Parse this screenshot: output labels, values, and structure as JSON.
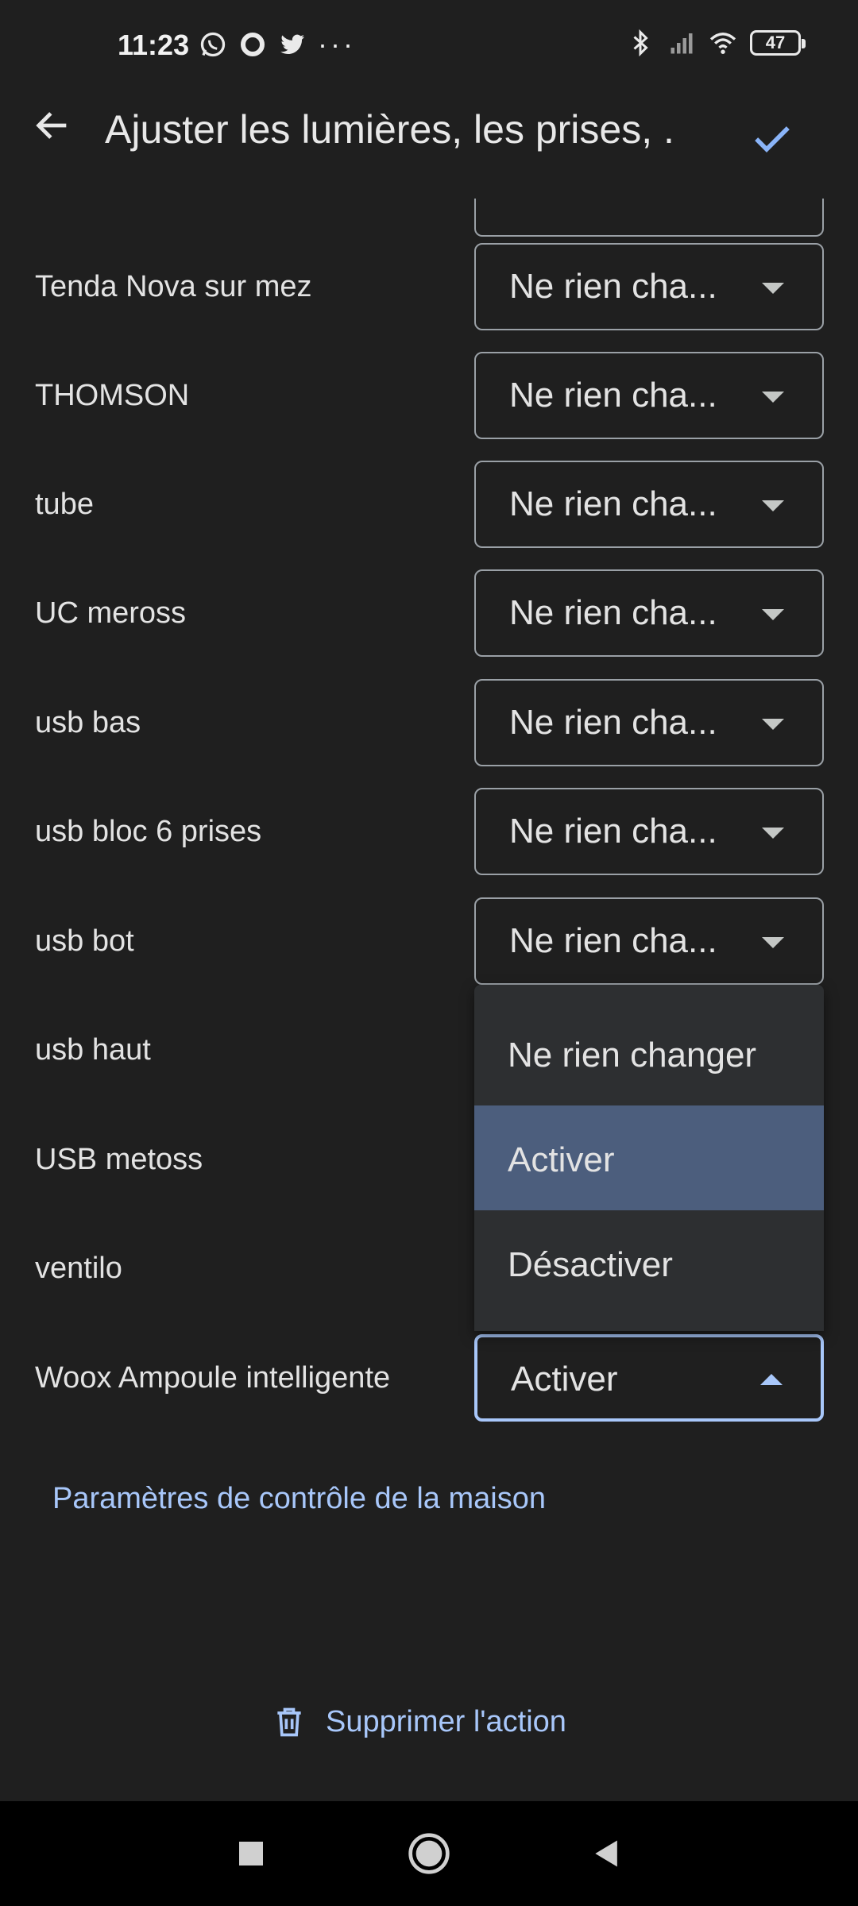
{
  "status_bar": {
    "time": "11:23",
    "battery": "47",
    "left_icons": [
      "whatsapp-icon",
      "circle-app-icon",
      "twitter-icon",
      "more-dots-icon"
    ],
    "right_icons": [
      "bluetooth-icon",
      "signal-icon",
      "wifi-icon",
      "battery-icon"
    ],
    "more": "···"
  },
  "app_bar": {
    "title": "Ajuster les lumières, les prises, ...",
    "back_icon": "arrow-left-icon",
    "confirm_icon": "check-icon",
    "accent": "#8ab4f8"
  },
  "devices": [
    {
      "name": "Tenda Nova sur mez",
      "value": "Ne rien cha..."
    },
    {
      "name": "THOMSON",
      "value": "Ne rien cha..."
    },
    {
      "name": "tube",
      "value": "Ne rien cha..."
    },
    {
      "name": "UC meross",
      "value": "Ne rien cha..."
    },
    {
      "name": "usb bas",
      "value": "Ne rien cha..."
    },
    {
      "name": "usb bloc 6 prises",
      "value": "Ne rien cha..."
    },
    {
      "name": "usb bot",
      "value": "Ne rien cha..."
    },
    {
      "name": "usb haut",
      "value": ""
    },
    {
      "name": "USB metoss",
      "value": ""
    },
    {
      "name": "ventilo",
      "value": ""
    },
    {
      "name": "Woox Ampoule intelligente",
      "value": "Activer"
    }
  ],
  "dropdown": {
    "options": [
      "Ne rien changer",
      "Activer",
      "Désactiver"
    ],
    "selected": "Activer"
  },
  "links": {
    "home_settings": "Paramètres de contrôle de la maison",
    "delete_action": "Supprimer l'action"
  },
  "colors": {
    "background": "#1f1f1f",
    "link": "#a8c7fa",
    "menu_selected": "#4c5e7d",
    "menu_background": "#2d2f31"
  }
}
